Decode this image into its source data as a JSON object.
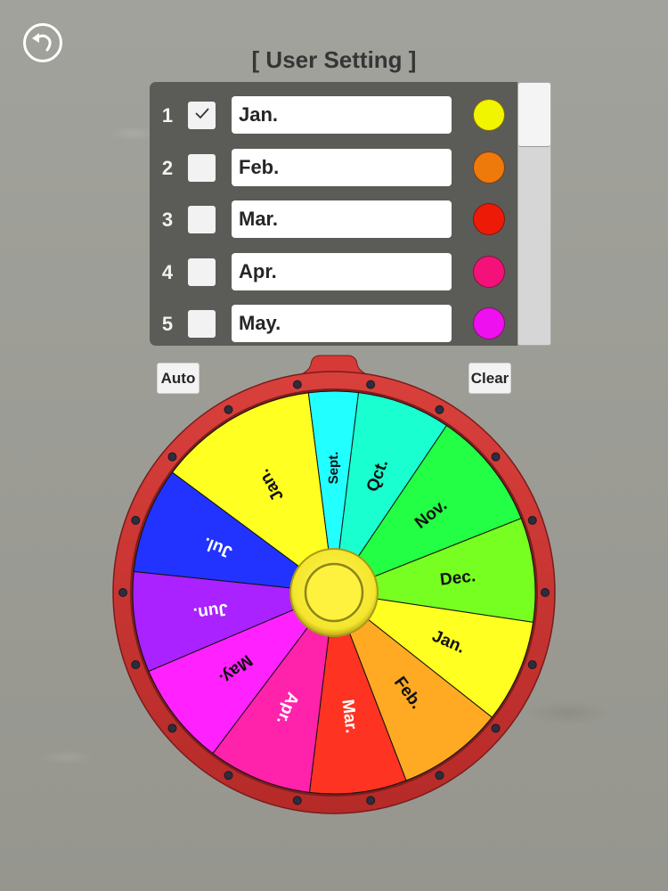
{
  "header": {
    "back_icon": "undo-arrow-icon",
    "title": "[ User Setting ]"
  },
  "settings_list": {
    "rows": [
      {
        "number": "1",
        "checked": true,
        "value": "Jan.",
        "color": "#f2f500"
      },
      {
        "number": "2",
        "checked": false,
        "value": "Feb.",
        "color": "#ee7a0c"
      },
      {
        "number": "3",
        "checked": false,
        "value": "Mar.",
        "color": "#ee1a08"
      },
      {
        "number": "4",
        "checked": false,
        "value": "Apr.",
        "color": "#f5117a"
      },
      {
        "number": "5",
        "checked": false,
        "value": "May.",
        "color": "#ee10ee"
      }
    ],
    "scroll_position": 0.0,
    "visible_fraction": 0.24
  },
  "buttons": {
    "auto_label": "Auto",
    "clear_label": "Clear"
  },
  "wheel": {
    "rim_color": "#c8312f",
    "hub_color": "#ffee33",
    "segments": [
      {
        "label": "Jan.",
        "color": "#ffff22",
        "text_color": "#111111",
        "span_deg": 46.1
      },
      {
        "label": "Sept.",
        "color": "#22ffff",
        "text_color": "#111111",
        "span_deg": 14.3
      },
      {
        "label": "Qct.",
        "color": "#1affd0",
        "text_color": "#111111",
        "span_deg": 27.0
      },
      {
        "label": "Nov.",
        "color": "#22ff44",
        "text_color": "#111111",
        "span_deg": 34.4
      },
      {
        "label": "Dec.",
        "color": "#77ff22",
        "text_color": "#111111",
        "span_deg": 30.1
      },
      {
        "label": "Jan.",
        "color": "#ffff22",
        "text_color": "#111111",
        "span_deg": 29.8
      },
      {
        "label": "Feb.",
        "color": "#ffaa22",
        "text_color": "#111111",
        "span_deg": 30.7
      },
      {
        "label": "Mar.",
        "color": "#ff3322",
        "text_color": "#ffffff",
        "span_deg": 28.0
      },
      {
        "label": "Apr.",
        "color": "#ff22aa",
        "text_color": "#ffffff",
        "span_deg": 30.0
      },
      {
        "label": "May.",
        "color": "#ff22ff",
        "text_color": "#111111",
        "span_deg": 30.0
      },
      {
        "label": "Jun.",
        "color": "#aa22ff",
        "text_color": "#ffffff",
        "span_deg": 29.0
      },
      {
        "label": "Jul.",
        "color": "#2233ff",
        "text_color": "#ffffff",
        "span_deg": 30.6
      }
    ]
  }
}
